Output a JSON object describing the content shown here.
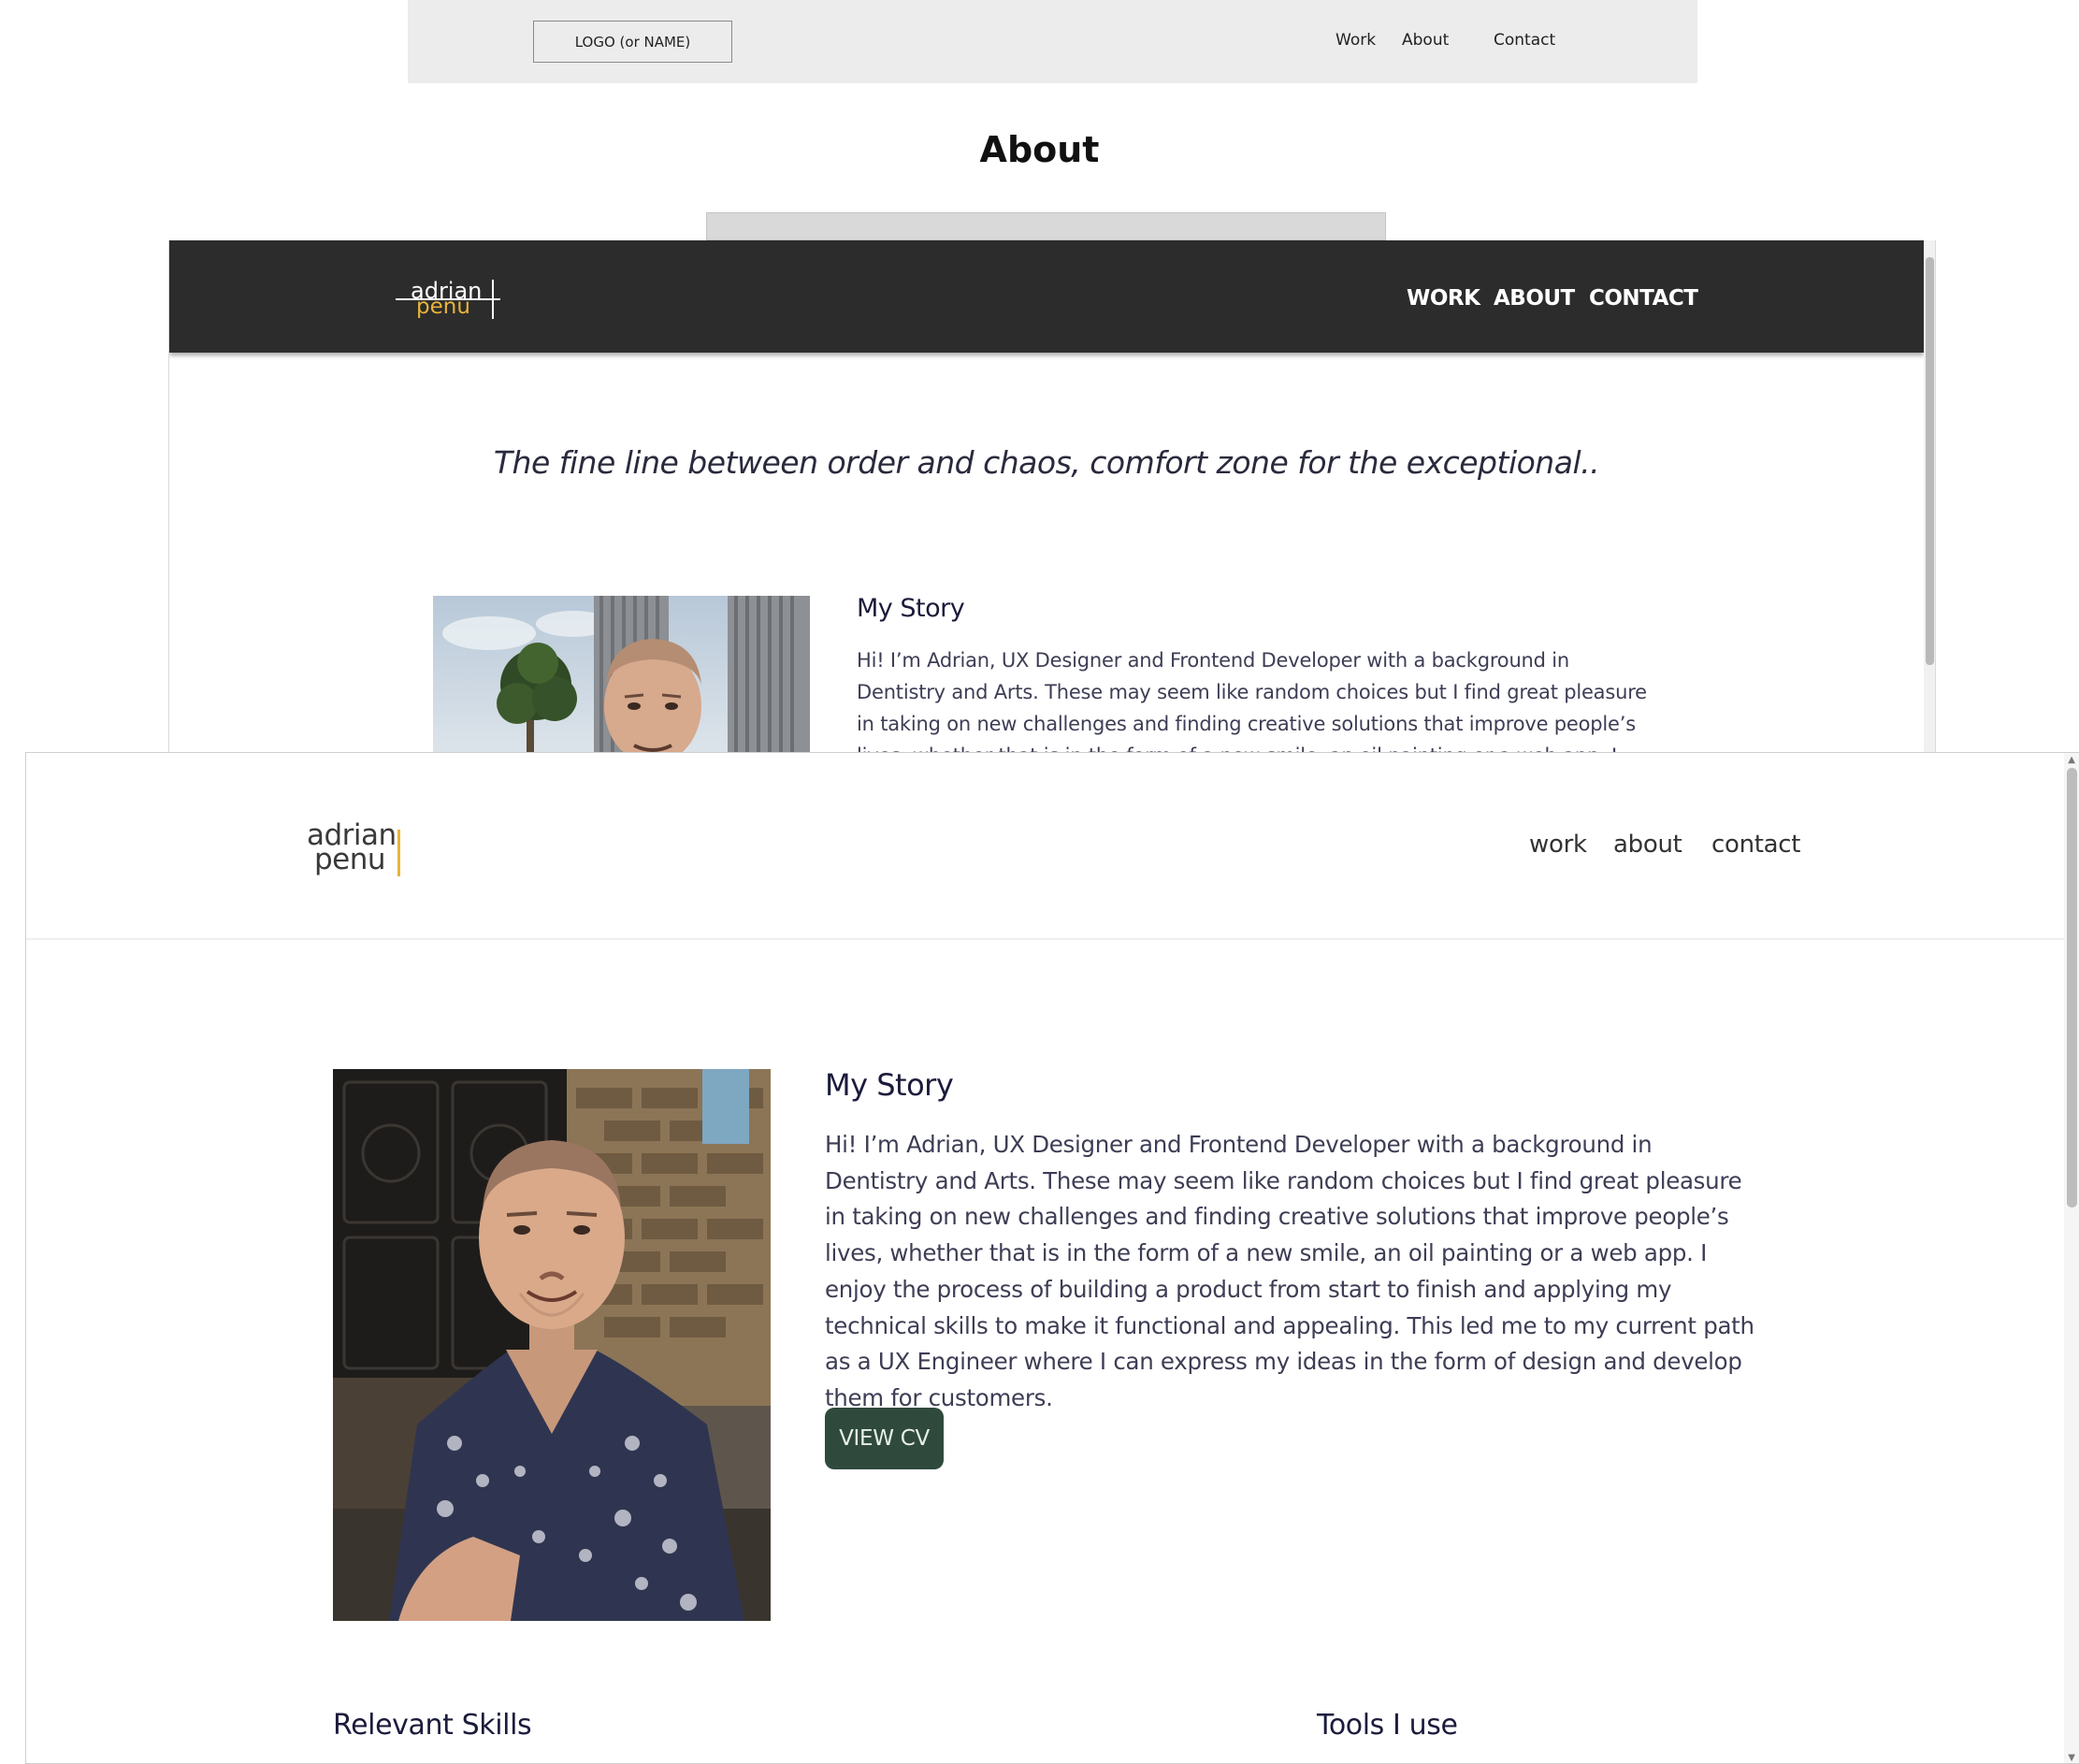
{
  "wireframe": {
    "logo_label": "LOGO (or NAME)",
    "nav": [
      "Work",
      "About",
      "Contact"
    ],
    "page_title": "About"
  },
  "dark_version": {
    "logo": {
      "first": "adrian",
      "last": "penu"
    },
    "nav": [
      "WORK",
      "ABOUT",
      "CONTACT"
    ],
    "tagline": "The fine line between order and chaos, comfort zone for the exceptional..",
    "story_title": "My Story",
    "story_text": "Hi! I’m Adrian, UX Designer and Frontend Developer with a background in Dentistry and Arts. These may seem like random choices but I find great pleasure in taking on new challenges and finding creative solutions that improve people’s lives, whether that is in the form of a new smile, an oil painting or a web app. I enjoy the process of"
  },
  "final_version": {
    "logo": {
      "first": "adrian",
      "last": "penu"
    },
    "nav": [
      "work",
      "about",
      "contact"
    ],
    "story_title": "My Story",
    "story_text": "Hi! I’m Adrian, UX Designer and Frontend Developer with a background in Dentistry and Arts. These may seem like random choices but I find great pleasure in taking on new challenges and finding creative solutions that improve people’s lives, whether that is in the form of a new smile, an oil painting or a web app. I enjoy the process of building a product from start to finish and applying my technical skills to make it functional and appealing. This led me to my current path as a UX Engineer where I can express my ideas in the form of design and develop them for customers.",
    "cv_button": "VIEW CV",
    "skills_heading": "Relevant Skills",
    "tools_heading": "Tools I use"
  },
  "colors": {
    "accent": "#e9b43a",
    "dark_header": "#2c2c2c",
    "button": "#2f4a3d",
    "heading_text": "#1b1b3c"
  }
}
